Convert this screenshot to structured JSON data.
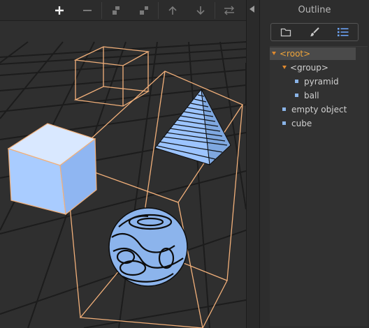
{
  "toolbar": {
    "buttons": [
      {
        "icon": "plus-icon",
        "active": true
      },
      {
        "icon": "minus-icon",
        "active": false
      },
      {
        "icon": "group-icon",
        "active": false
      },
      {
        "icon": "ungroup-icon",
        "active": false
      },
      {
        "icon": "arrow-up-icon",
        "active": false
      },
      {
        "icon": "arrow-down-icon",
        "active": false
      },
      {
        "icon": "swap-icon",
        "active": false
      }
    ]
  },
  "outline": {
    "title": "Outline",
    "tabs": [
      {
        "icon": "folder-icon"
      },
      {
        "icon": "brush-icon"
      },
      {
        "icon": "list-icon",
        "active": true
      }
    ],
    "tree": [
      {
        "label": "<root>",
        "depth": 0,
        "type": "group",
        "selected": true
      },
      {
        "label": "<group>",
        "depth": 1,
        "type": "group"
      },
      {
        "label": "pyramid",
        "depth": 2,
        "type": "object"
      },
      {
        "label": "ball",
        "depth": 2,
        "type": "object"
      },
      {
        "label": "empty object",
        "depth": 1,
        "type": "object"
      },
      {
        "label": "cube",
        "depth": 1,
        "type": "object"
      }
    ]
  },
  "colors": {
    "accent": "#f0a53a",
    "selection_outline": "#f2b07a",
    "object_fill": "#9cc4ff",
    "object_bullet": "#8ab4e8",
    "grid_line": "#1c1c1c"
  }
}
